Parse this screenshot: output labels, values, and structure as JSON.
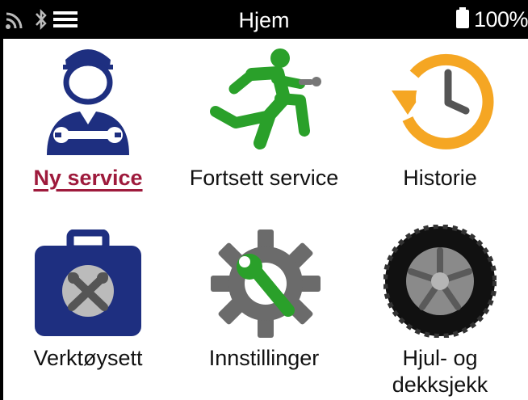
{
  "status_bar": {
    "title": "Hjem",
    "battery_level": "100%",
    "icons": [
      "signal-icon",
      "bluetooth-icon",
      "menu-icon",
      "battery-icon"
    ]
  },
  "menu": {
    "items": [
      {
        "label": "Ny service",
        "icon": "mechanic-icon",
        "selected": true
      },
      {
        "label": "Fortsett service",
        "icon": "running-man-wrench-icon",
        "selected": false
      },
      {
        "label": "Historie",
        "icon": "history-clock-icon",
        "selected": false
      },
      {
        "label": "Verktøysett",
        "icon": "toolbox-icon",
        "selected": false
      },
      {
        "label": "Innstillinger",
        "icon": "gear-wrench-icon",
        "selected": false
      },
      {
        "label_line1": "Hjul- og",
        "label_line2": "dekksjekk",
        "icon": "tire-icon",
        "selected": false
      }
    ]
  },
  "colors": {
    "selected_text": "#9e1a3c",
    "navy": "#1e2f80",
    "green": "#2aa02a",
    "orange": "#f5a623",
    "gray": "#6b6b6b"
  }
}
